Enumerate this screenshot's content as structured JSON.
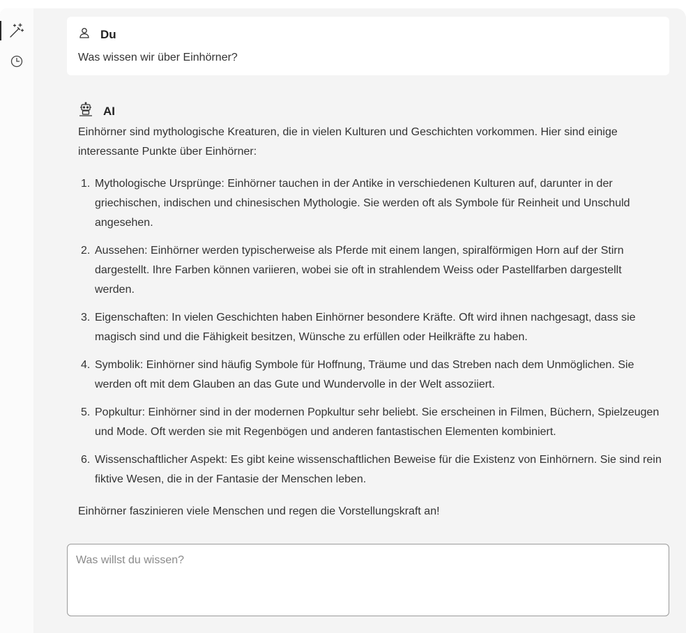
{
  "sidebar": {
    "items": [
      {
        "icon": "magic-wand-icon",
        "active": true
      },
      {
        "icon": "history-clock-icon",
        "active": false
      }
    ]
  },
  "chat": {
    "user": {
      "name": "Du",
      "message": "Was wissen wir über Einhörner?"
    },
    "ai": {
      "name": "AI",
      "intro": "Einhörner sind mythologische Kreaturen, die in vielen Kulturen und Geschichten vorkommen. Hier sind einige interessante Punkte über Einhörner:",
      "points": [
        {
          "num": "1.",
          "text": "Mythologische Ursprünge: Einhörner tauchen in der Antike in verschiedenen Kulturen auf, darunter in der griechischen, indischen und chinesischen Mythologie. Sie werden oft als Symbole für Reinheit und Unschuld angesehen."
        },
        {
          "num": "2.",
          "text": "Aussehen: Einhörner werden typischerweise als Pferde mit einem langen, spiralförmigen Horn auf der Stirn dargestellt. Ihre Farben können variieren, wobei sie oft in strahlendem Weiss oder Pastellfarben dargestellt werden."
        },
        {
          "num": "3.",
          "text": "Eigenschaften: In vielen Geschichten haben Einhörner besondere Kräfte. Oft wird ihnen nachgesagt, dass sie magisch sind und die Fähigkeit besitzen, Wünsche zu erfüllen oder Heilkräfte zu haben."
        },
        {
          "num": "4.",
          "text": "Symbolik: Einhörner sind häufig Symbole für Hoffnung, Träume und das Streben nach dem Unmöglichen. Sie werden oft mit dem Glauben an das Gute und Wundervolle in der Welt assoziiert."
        },
        {
          "num": "5.",
          "text": "Popkultur: Einhörner sind in der modernen Popkultur sehr beliebt. Sie erscheinen in Filmen, Büchern, Spielzeugen und Mode. Oft werden sie mit Regenbögen und anderen fantastischen Elementen kombiniert."
        },
        {
          "num": "6.",
          "text": "Wissenschaftlicher Aspekt: Es gibt keine wissenschaftlichen Beweise für die Existenz von Einhörnern. Sie sind rein fiktive Wesen, die in der Fantasie der Menschen leben."
        }
      ],
      "outro": "Einhörner faszinieren viele Menschen und regen die Vorstellungskraft an!"
    }
  },
  "composer": {
    "placeholder": "Was willst du wissen?",
    "value": ""
  }
}
